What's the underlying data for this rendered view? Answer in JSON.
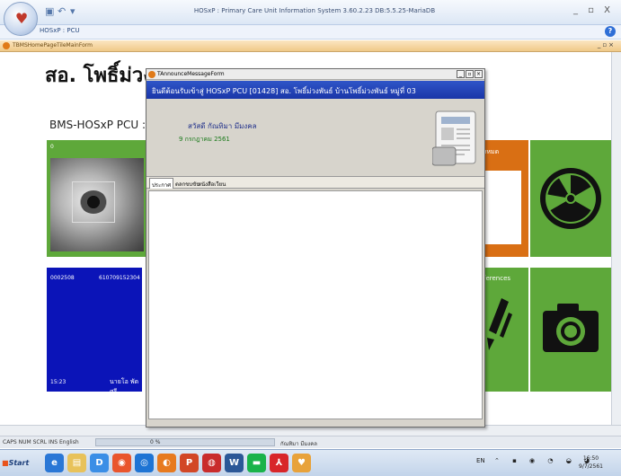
{
  "window": {
    "title": "HOSxP : Primary Care Unit Information System 3.60.2.23 DB:5.5.25-MariaDB",
    "controls": "_ ▫ X"
  },
  "ribbon": {
    "tab": "HOSxP : PCU",
    "help": "?"
  },
  "mdi": {
    "title": "TBMSHomePageTileMainForm",
    "controls": "_▫×"
  },
  "main": {
    "heading": "สอ. โพธิ์ม่วง",
    "version": "BMS-HOSxP PCU : 3.60."
  },
  "tiles": {
    "eye": {
      "number": "0"
    },
    "blue": {
      "top_left": "0002508",
      "top_right": "610709152304",
      "bottom_left": "15:23",
      "bottom_right": "นายโอ พัดศรี"
    },
    "orange": {
      "label": "ั้งหมด"
    },
    "green2": {
      "label": "ferences"
    }
  },
  "announce": {
    "title": "TAnnounceMessageForm",
    "banner": "ยินดีต้อนรับเข้าสู่ HOSxP PCU [01428] สอ. โพธิ์ม่วงพันธ์ บ้านโพธิ์ม่วงพันธ์ หมู่ที่ 03",
    "greeting": "สวัสดี กัณทิมา  มีมงคล",
    "date": "9 กรกฎาคม 2561",
    "tabs": [
      "ประกาศ",
      "ตลกขบขัน",
      "หนังสือเวียน"
    ]
  },
  "statusbar": {
    "keys": "CAPS  NUM  SCRL  INS  English",
    "progress_label": "0 %",
    "progress": 0.0,
    "user": "กัณทิมา  มีมงคล"
  },
  "taskbar": {
    "start": "Start",
    "lang": "EN",
    "time": "16:50",
    "date": "9/7/2561"
  },
  "colors": {
    "tile_green": "#5ea83a",
    "tile_blue": "#0b14b8",
    "tile_orange": "#d96f14",
    "banner": "#1a36a8"
  }
}
